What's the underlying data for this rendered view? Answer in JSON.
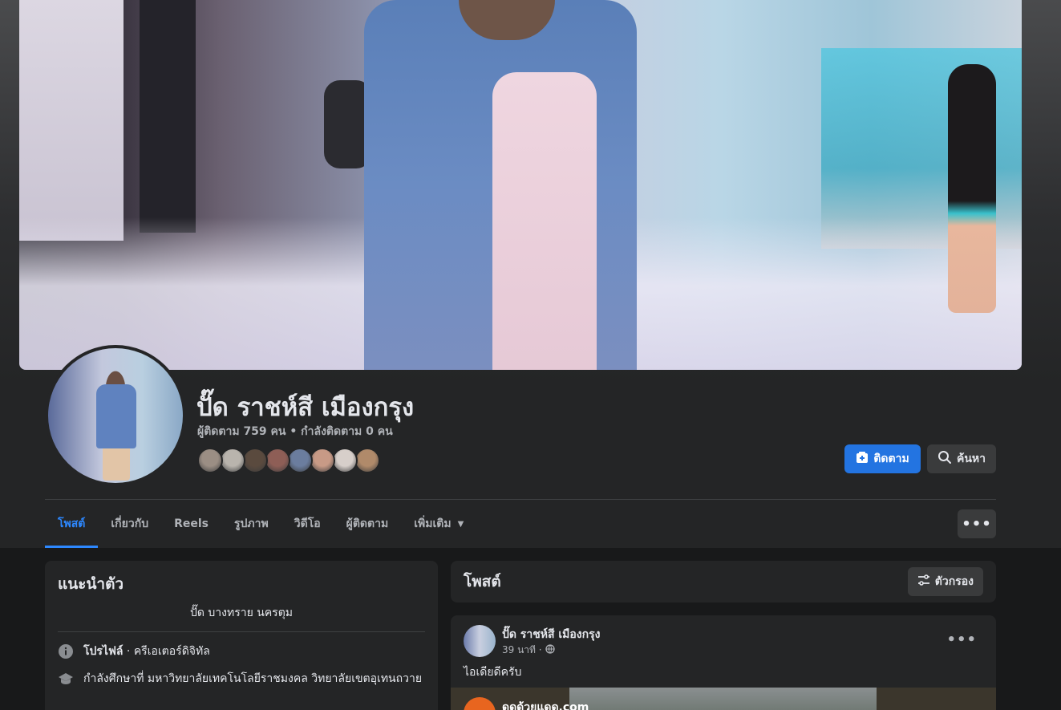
{
  "profile": {
    "name": "ปั๊ด ราชห์สี เมืองกรุง",
    "stats": "ผู้ติดตาม 759 คน • กำลังติดตาม 0 คน",
    "friend_faces": [
      "#9b8e84",
      "#b9b4ad",
      "#5a4a3e",
      "#8e5e56",
      "#6b7d9e",
      "#c89a86",
      "#d7cfca",
      "#b08a6a"
    ]
  },
  "actions": {
    "follow_label": "ติดตาม",
    "search_label": "ค้นหา",
    "more_label": "•••"
  },
  "tabs": [
    {
      "label": "โพสต์",
      "active": true
    },
    {
      "label": "เกี่ยวกับ",
      "active": false
    },
    {
      "label": "Reels",
      "active": false
    },
    {
      "label": "รูปภาพ",
      "active": false
    },
    {
      "label": "วิดีโอ",
      "active": false
    },
    {
      "label": "ผู้ติดตาม",
      "active": false
    },
    {
      "label": "เพิ่มเติม",
      "active": false
    }
  ],
  "intro": {
    "title": "แนะนำตัว",
    "bio": "ปั๊ด บางทราย นครตุม",
    "rows": [
      {
        "bold": "โปรไฟล์",
        "text": " · ครีเอเตอร์ดิจิทัล"
      },
      {
        "bold": "",
        "text": "กำลังศึกษาที่ มหาวิทยาลัยเทคโนโลยีราชมงคล วิทยาลัยเขตอุเทนถวาย"
      }
    ]
  },
  "posts": {
    "title": "โพสต์",
    "filter_label": "ตัวกรอง",
    "items": [
      {
        "author": "ปั๊ด ราชห์สี เมืองกรุง",
        "time": "39 นาที ·",
        "text": "ไอเดียดีครับ",
        "link_site": "ดูดด้วยแดด.com"
      }
    ]
  },
  "colors": {
    "accent": "#2d88ff",
    "follow_button": "#2374e1",
    "card": "#242526",
    "background": "#18191a"
  }
}
